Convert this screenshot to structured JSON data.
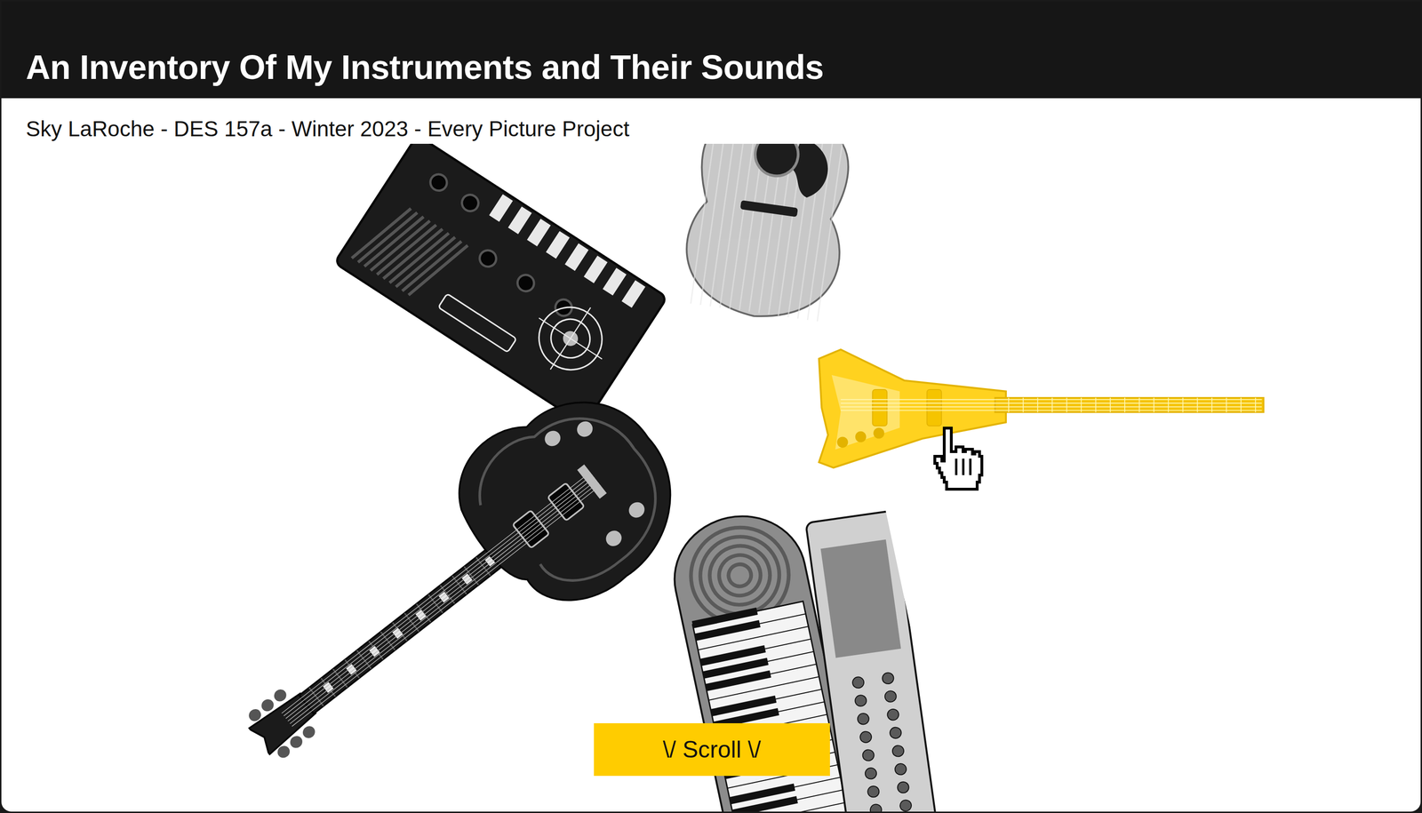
{
  "page": {
    "title": "An Inventory Of My Instruments and Their Sounds",
    "subtitle": "Sky LaRoche - DES 157a - Winter 2023 - Every Picture Project"
  },
  "instruments": [
    {
      "kind": "synth",
      "selected": false
    },
    {
      "kind": "acoustic",
      "selected": false
    },
    {
      "kind": "bass",
      "selected": true
    },
    {
      "kind": "electric",
      "selected": false
    },
    {
      "kind": "keyboard",
      "selected": false
    }
  ],
  "scroll_button": "\\/ Scroll \\/"
}
